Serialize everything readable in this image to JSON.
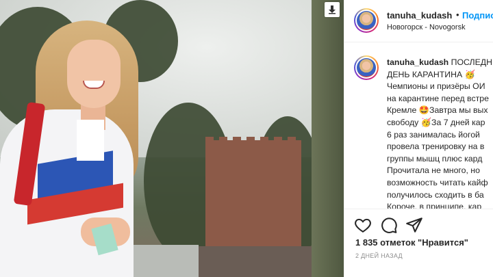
{
  "photo": {
    "download_icon": "download-icon"
  },
  "header": {
    "username": "tanuha_kudash",
    "separator": "•",
    "follow_label": "Подписаться",
    "location": "Новогорск - Novogorsk"
  },
  "caption": {
    "lines": [
      "ПОСЛЕДНИЙ",
      "ДЕНЬ КАРАНТИНА 🥳",
      "Чемпионы и призёры ОИ",
      "на карантине перед встре",
      "Кремле 🤩Завтра мы вых",
      "свободу 🥳За 7 дней кар",
      "6 раз занималась йогой",
      "провела тренировку на в",
      "группы мышц плюс кард",
      "Прочитала не много, но",
      "возможность читать кайф",
      "получилось сходить в ба",
      "Короче, в принципе, кар"
    ]
  },
  "actions": {
    "icons": [
      "heart-icon",
      "comment-icon",
      "share-icon"
    ],
    "likes": "1 835 отметок \"Нравится\"",
    "time_ago": "2 ДНЕЙ НАЗАД"
  },
  "colors": {
    "link": "#0095f6",
    "text": "#262626",
    "muted": "#8e8e8e",
    "divider": "#efefef"
  }
}
